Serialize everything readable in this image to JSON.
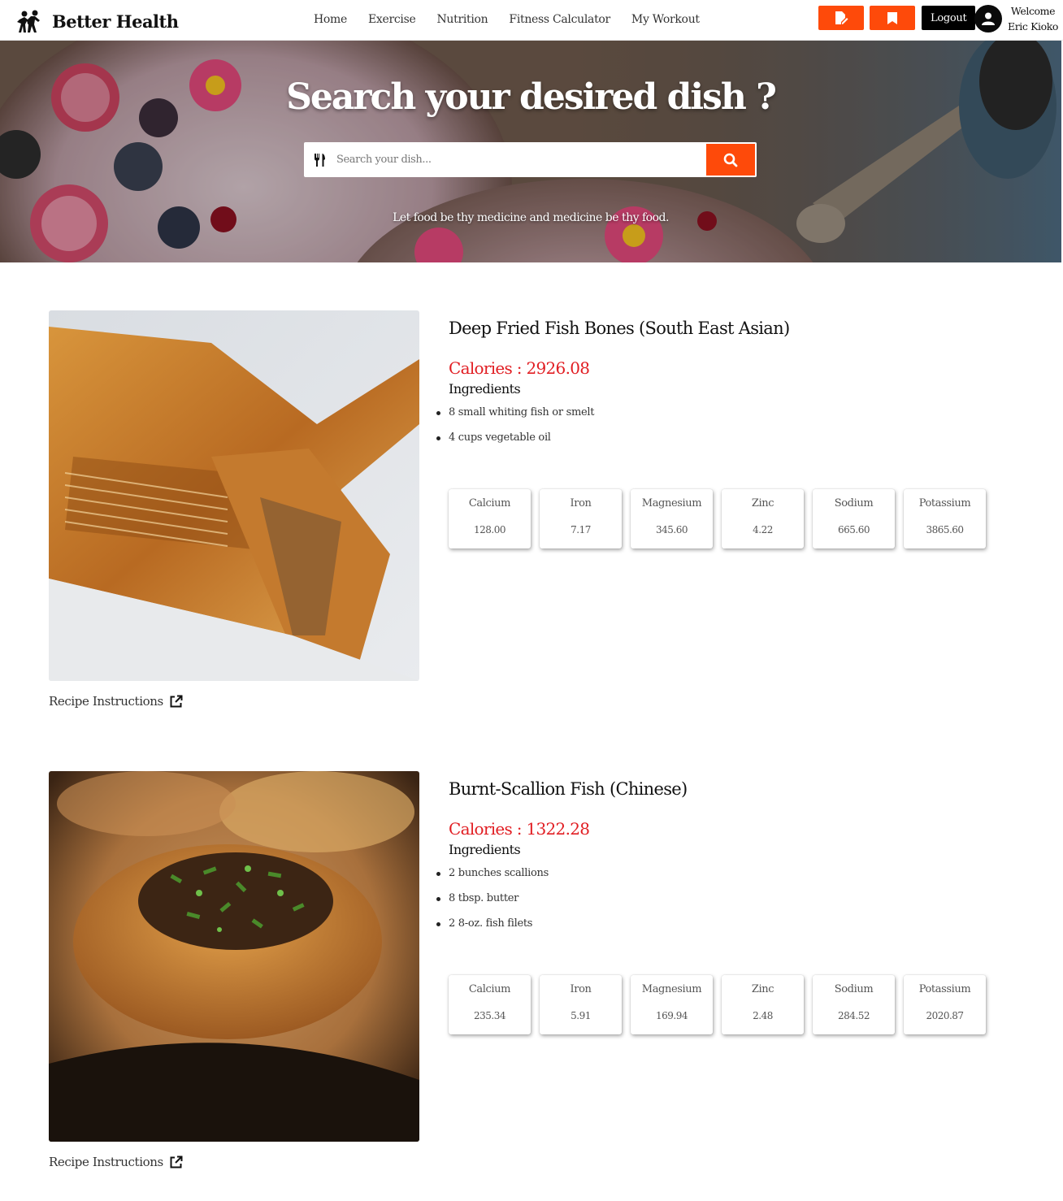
{
  "brand": {
    "name": "Better Health",
    "logo_icon": "family-silhouette-icon"
  },
  "nav": {
    "links": [
      "Home",
      "Exercise",
      "Nutrition",
      "Fitness Calculator",
      "My Workout"
    ],
    "logout_label": "Logout",
    "action_icons": [
      "edit-note-icon",
      "bookmark-icon"
    ],
    "accent": "#fe4a0a"
  },
  "user": {
    "welcome": "Welcome",
    "name": "Eric Kioko",
    "icon": "user-avatar-icon"
  },
  "hero": {
    "title": "Search your desired dish ?",
    "search_placeholder": "Search your dish...",
    "search_icon": "search-icon",
    "utensils_icon": "utensils-icon",
    "quote": "Let food be thy medicine and medicine be thy food."
  },
  "recipes": [
    {
      "title": "Deep Fried Fish Bones (South East Asian)",
      "calories": "Calories : 2926.08",
      "ingredients_heading": "Ingredients",
      "ingredients": [
        "8 small whiting fish or smelt",
        "4 cups vegetable oil"
      ],
      "minerals": [
        {
          "name": "Calcium",
          "value": "128.00"
        },
        {
          "name": "Iron",
          "value": "7.17"
        },
        {
          "name": "Magnesium",
          "value": "345.60"
        },
        {
          "name": "Zinc",
          "value": "4.22"
        },
        {
          "name": "Sodium",
          "value": "665.60"
        },
        {
          "name": "Potassium",
          "value": "3865.60"
        }
      ],
      "link_label": "Recipe Instructions"
    },
    {
      "title": "Burnt-Scallion Fish (Chinese)",
      "calories": "Calories : 1322.28",
      "ingredients_heading": "Ingredients",
      "ingredients": [
        "2 bunches scallions",
        "8 tbsp. butter",
        "2 8-oz. fish filets"
      ],
      "minerals": [
        {
          "name": "Calcium",
          "value": "235.34"
        },
        {
          "name": "Iron",
          "value": "5.91"
        },
        {
          "name": "Magnesium",
          "value": "169.94"
        },
        {
          "name": "Zinc",
          "value": "2.48"
        },
        {
          "name": "Sodium",
          "value": "284.52"
        },
        {
          "name": "Potassium",
          "value": "2020.87"
        }
      ],
      "link_label": "Recipe Instructions"
    }
  ]
}
